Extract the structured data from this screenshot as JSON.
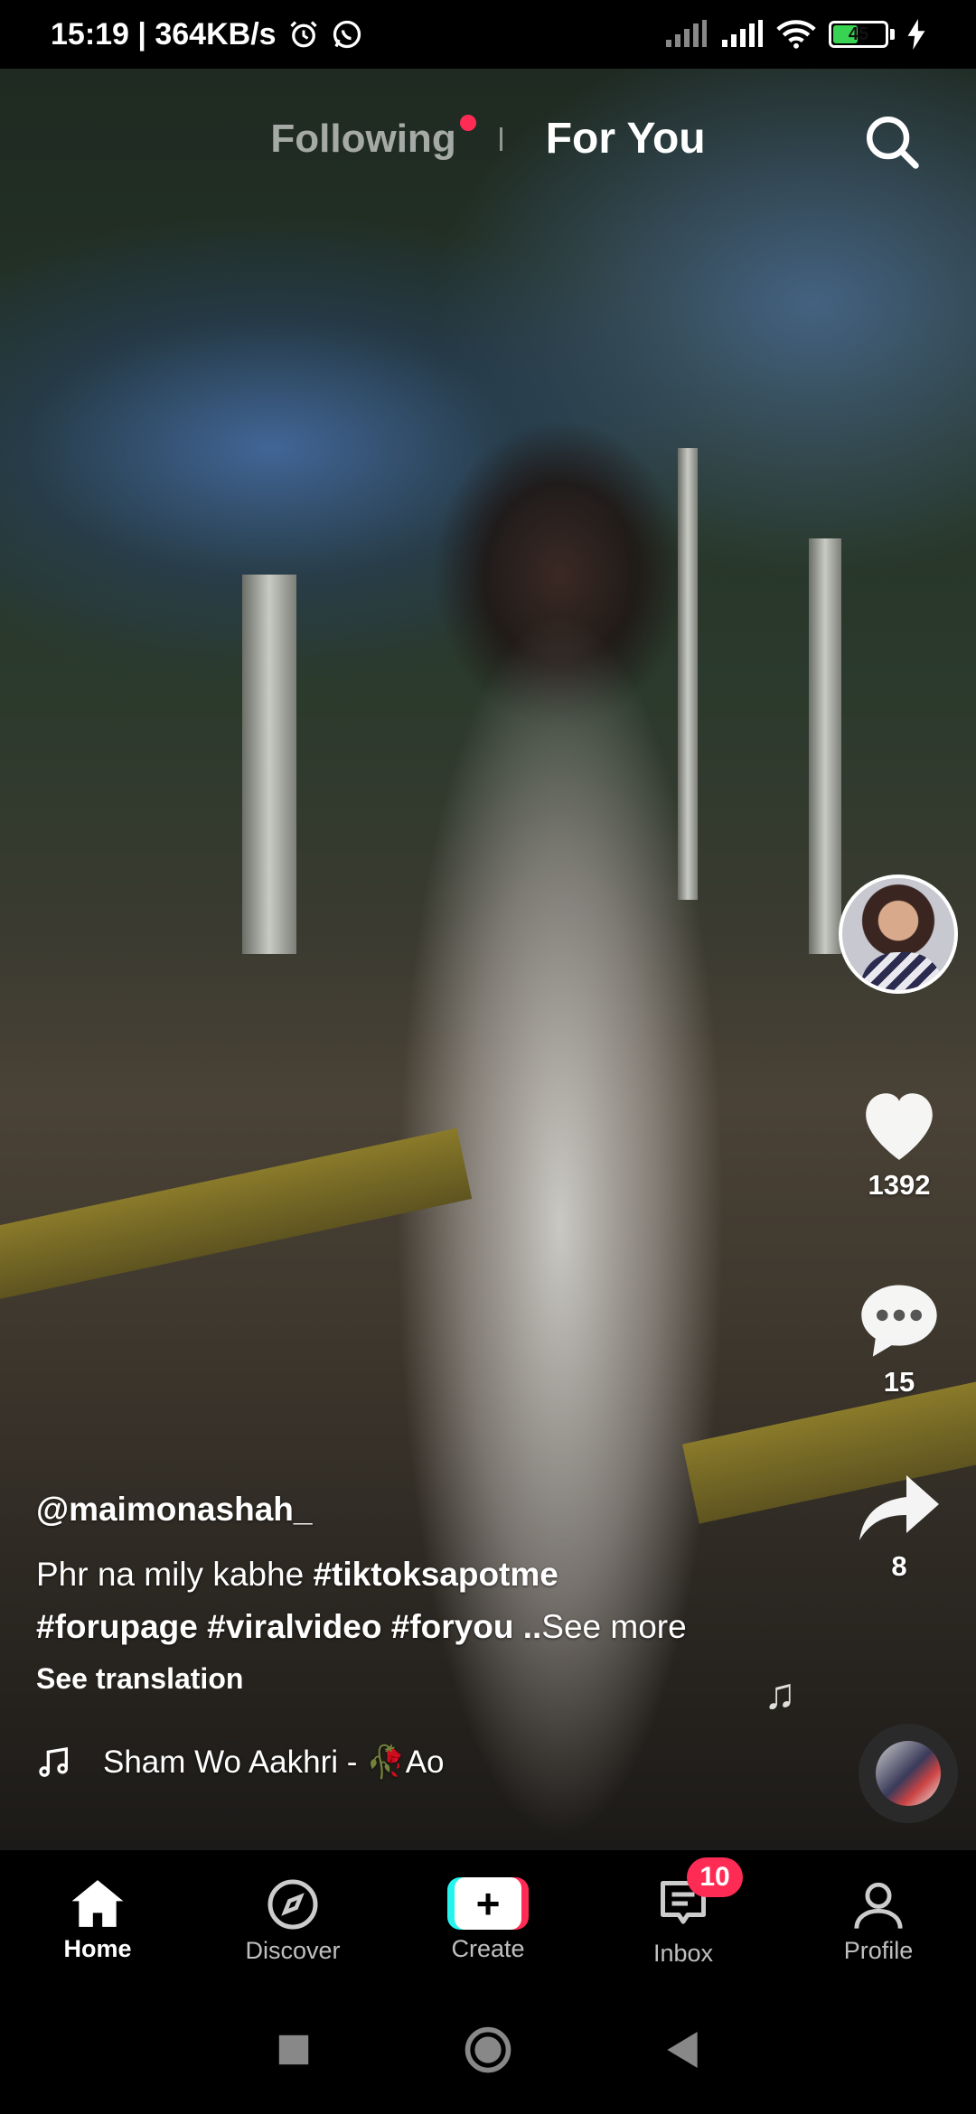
{
  "status_bar": {
    "time_speed": "15:19 | 364KB/s",
    "battery": "45",
    "icons": [
      "alarm-icon",
      "whatsapp-icon",
      "signal-icon",
      "signal-icon",
      "wifi-icon",
      "battery-icon",
      "charging-icon"
    ]
  },
  "top_nav": {
    "following": "Following",
    "for_you": "For You",
    "accent": "#fe2c55"
  },
  "rail": {
    "likes": "1392",
    "comments": "15",
    "shares": "8"
  },
  "post": {
    "username": "@maimonashah_",
    "desc_text": "Phr na mily kabhe ",
    "tag1": "#tiktoksapotme",
    "tags_line2": "#forupage #viralvideo #foryou ..",
    "see_more": "See more",
    "see_translation": "See translation",
    "music": "Sham Wo Aakhri - 🥀Ao"
  },
  "bottom_nav": {
    "home": "Home",
    "discover": "Discover",
    "create": "Create",
    "inbox": "Inbox",
    "inbox_badge": "10",
    "profile": "Profile"
  }
}
